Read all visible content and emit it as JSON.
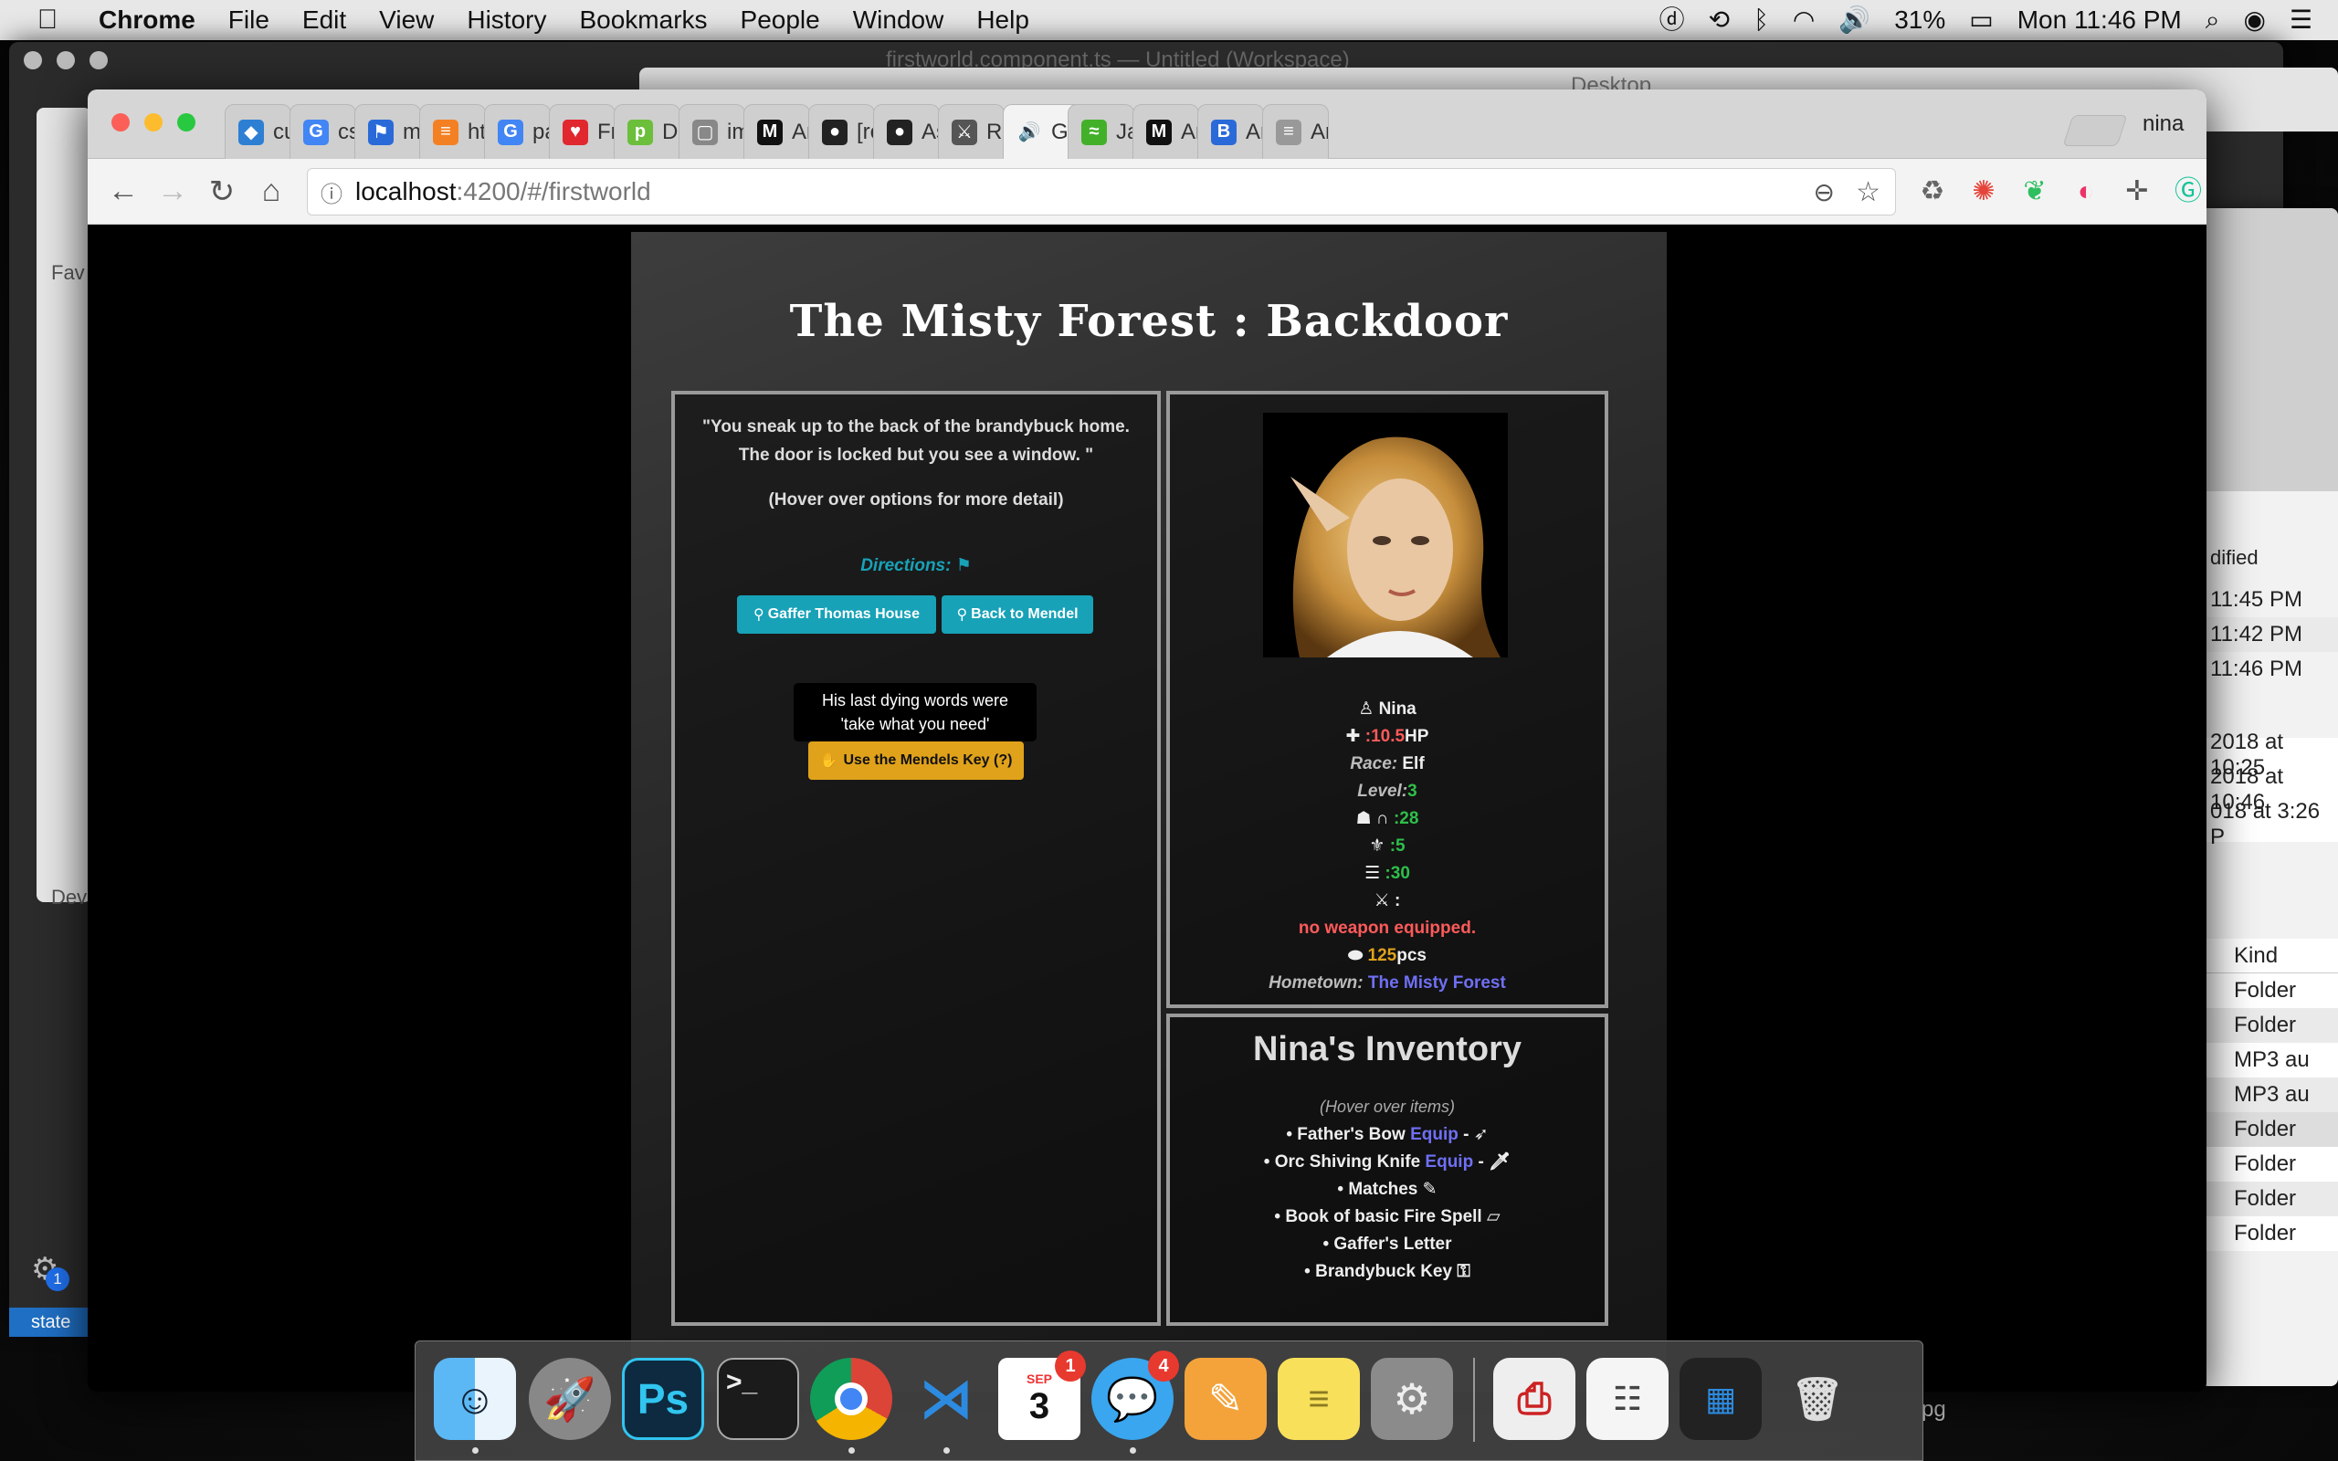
{
  "menubar": {
    "app": "Chrome",
    "items": [
      "File",
      "Edit",
      "View",
      "History",
      "Bookmarks",
      "People",
      "Window",
      "Help"
    ],
    "battery": "31%",
    "clock": "Mon 11:46 PM"
  },
  "bg_windows": {
    "editor_title": "firstworld.component.ts — Untitled (Workspace)",
    "desktop_title": "Desktop",
    "vs_sidebar_label": "Fav",
    "vs_sidebar_label2": "Dev",
    "vs_status": "state",
    "vs_badge": "1",
    "finder_header": "dified",
    "finder_times": [
      "11:45 PM",
      "11:42 PM",
      "11:46 PM"
    ],
    "finder_dates": [
      "2018 at 10:25",
      "2018 at 10:46",
      "018 at 3:26 P"
    ],
    "finder_kind_header": "Kind",
    "finder_kinds": [
      "Folder",
      "Folder",
      "MP3 au",
      "MP3 au",
      "Folder",
      "Folder",
      "Folder",
      "Folder"
    ],
    "behind_dock_text": "pg"
  },
  "browser": {
    "profile": "nina",
    "tabs": [
      {
        "label": "cur",
        "fav": "◆",
        "color": "#2d7fd3"
      },
      {
        "label": "css",
        "fav": "G",
        "color": "#4285f4"
      },
      {
        "label": "mus",
        "fav": "⚑",
        "color": "#2a6ad8"
      },
      {
        "label": "htm",
        "fav": "≡",
        "color": "#f48024"
      },
      {
        "label": "parc",
        "fav": "G",
        "color": "#4285f4"
      },
      {
        "label": "Fre",
        "fav": "♥",
        "color": "#e0282e"
      },
      {
        "label": "Du",
        "fav": "p",
        "color": "#6bbf3a"
      },
      {
        "label": "ima",
        "fav": "▢",
        "color": "#888888"
      },
      {
        "label": "Ang",
        "fav": "M",
        "color": "#111111"
      },
      {
        "label": "[rej",
        "fav": "●",
        "color": "#222222"
      },
      {
        "label": "Ass",
        "fav": "●",
        "color": "#222222"
      },
      {
        "label": "RPG",
        "fav": "⚔",
        "color": "#555555"
      },
      {
        "label": "G",
        "fav": "🔊",
        "color": "#f3f3f3"
      },
      {
        "label": "Java",
        "fav": "≈",
        "color": "#43b02a"
      },
      {
        "label": "Ang",
        "fav": "M",
        "color": "#111111"
      },
      {
        "label": "Ang",
        "fav": "B",
        "color": "#2a6ad8"
      },
      {
        "label": "Ang",
        "fav": "≡",
        "color": "#999999"
      }
    ],
    "url_host": "localhost",
    "url_path": ":4200/#/firstworld"
  },
  "game": {
    "title": "The Misty Forest : Backdoor",
    "story_line1": "\"You sneak up to the back of the brandybuck home.",
    "story_line2": "The door is locked but you see a window. \"",
    "hover_hint": "(Hover over options for more detail)",
    "directions_label": "Directions:",
    "dir_buttons": [
      "Gaffer Thomas House",
      "Back to Mendel"
    ],
    "tooltip_line1": "His last dying words were",
    "tooltip_line2": "'take what you need'",
    "action_button": "Use the Mendels Key (?)",
    "character": {
      "name": "Nina",
      "hp_label": ":",
      "hp": "10.5",
      "hp_unit": "HP",
      "race_label": "Race:",
      "race": "Elf",
      "level_label": "Level:",
      "level": "3",
      "stat1": ":28",
      "stat2": ":5",
      "stat3": ":30",
      "weapon_sep": ":",
      "weapon": "no weapon equipped.",
      "gold": "125",
      "gold_unit": "pcs",
      "hometown_label": "Hometown:",
      "hometown": "The Misty Forest"
    },
    "inventory_title": "Nina's Inventory",
    "inventory_hint": "(Hover over items)",
    "inventory": [
      {
        "name": "Father's Bow",
        "equip": "Equip",
        "suffix": " - "
      },
      {
        "name": "Orc Shiving Knife",
        "equip": "Equip",
        "suffix": " - "
      },
      {
        "name": "Matches",
        "equip": "",
        "suffix": ""
      },
      {
        "name": "Book of basic Fire Spell",
        "equip": "",
        "suffix": ""
      },
      {
        "name": "Gaffer's Letter",
        "equip": "",
        "suffix": ""
      },
      {
        "name": "Brandybuck Key",
        "equip": "",
        "suffix": ""
      }
    ]
  },
  "dock": {
    "calendar_month": "SEP",
    "calendar_day": "3",
    "calendar_badge": "1",
    "messages_badge": "4",
    "ps_label": "Ps"
  }
}
